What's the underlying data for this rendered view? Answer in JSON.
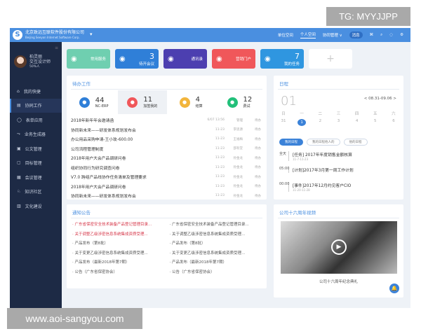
{
  "overlay_tag": "TG: MYYJJPP",
  "watermark": "www.aoi-sangyou.com",
  "header": {
    "company": "北京致远互联软件股份有限公司",
    "company_en": "Beijing Seeyon Internet Software Corp.",
    "nav": [
      "单位空间",
      "个人空间",
      "协同管理 ∨"
    ],
    "badge": "消息"
  },
  "user": {
    "name": "柏灵丽",
    "title": "交互设计师",
    "dept": "50%人"
  },
  "sidebar": {
    "items": [
      "我的快捷",
      "协同工作",
      "表单应用",
      "业务生成器",
      "公文管理",
      "目标管理",
      "会议管理",
      "知识社区",
      "文化建设"
    ],
    "active": 1
  },
  "tiles": [
    {
      "label": "常用服务",
      "num": "",
      "color": "#6fcfb0",
      "icon": "service-icon"
    },
    {
      "label": "待开会议",
      "num": "3",
      "color": "#2f7fd8",
      "icon": "meeting-icon"
    },
    {
      "label": "通讯录",
      "num": "",
      "color": "#4c3fb0",
      "icon": "contacts-icon"
    },
    {
      "label": "营销门户",
      "num": "",
      "color": "#f0575a",
      "icon": "portal-icon"
    },
    {
      "label": "我的任务",
      "num": "7",
      "color": "#2f96e0",
      "icon": "star-icon"
    }
  ],
  "todo": {
    "title": "待办工作",
    "stats": [
      {
        "n": "44",
        "l": "NC-ERP",
        "color": "#2f7fd8"
      },
      {
        "n": "11",
        "l": "加签我的",
        "color": "#f0575a"
      },
      {
        "n": "4",
        "l": "结算",
        "color": "#f2b53c"
      },
      {
        "n": "12",
        "l": "费试",
        "color": "#22c07a"
      }
    ],
    "rows": [
      {
        "t": "2018年新年年会邀请函",
        "d": "6/07 13:56",
        "p": "管理",
        "s": "待办"
      },
      {
        "t": "协同新未来——研发体系规划发布会",
        "d": "11-23",
        "p": "李思源",
        "s": "待办"
      },
      {
        "t": "办公用品采购申请-王小玫-600.00",
        "d": "11-23",
        "p": "王福梅",
        "s": "待办"
      },
      {
        "t": "公司流程管理制度",
        "d": "11-23",
        "p": "邵有堂",
        "s": "待办"
      },
      {
        "t": "2018年用户大会产品调研问卷",
        "d": "11-23",
        "p": "孙金龙",
        "s": "待办"
      },
      {
        "t": "组织协同行为研究调查问卷",
        "d": "11-23",
        "p": "孙金龙",
        "s": "待办"
      },
      {
        "t": "V7.0 跨组产品线协作任务清单及管理要求",
        "d": "11-23",
        "p": "孙金龙",
        "s": "待办"
      },
      {
        "t": "2018年用户大会产品调研问卷",
        "d": "11-23",
        "p": "孙金龙",
        "s": "待办"
      },
      {
        "t": "协同新未来——研发体系规划发布会",
        "d": "11-23",
        "p": "孙金龙",
        "s": "待办"
      }
    ]
  },
  "schedule": {
    "title": "日程",
    "big": "01",
    "range": "< 08.31-09.06 >",
    "week": [
      "日",
      "一",
      "二",
      "三",
      "四",
      "五",
      "六"
    ],
    "days": [
      "31",
      "1",
      "2",
      "3",
      "4",
      "5",
      "6"
    ],
    "today": 1,
    "filters": [
      "我的日程",
      "我的日程他人的",
      "他的日程"
    ],
    "events": [
      {
        "tm": "全天",
        "t": "[任务] 2017年年度销售金额核算",
        "s": "11-7-11-23"
      },
      {
        "tm": "05:00",
        "t": "[计划]2017年3月第一周工作计划",
        "s": ""
      },
      {
        "tm": "00:00",
        "t": "[事件]2017年12月约见客户CIO",
        "s": "11-20-11-28"
      }
    ]
  },
  "notices": {
    "title": "通知公告",
    "items": [
      {
        "t": "· 广东省保密安全技术装备产品登记管理目录...",
        "red": true
      },
      {
        "t": "· 广东省保密安全技术装备产品登记管理目录...",
        "red": false
      },
      {
        "t": "· 关于调整乙级涉密信息系统集成资质受理...",
        "red": true
      },
      {
        "t": "· 关于调整乙级涉密信息系统集成资质受理...",
        "red": false
      },
      {
        "t": "· 产品发布（第8批）",
        "red": false
      },
      {
        "t": "· 产品发布（第8批）",
        "red": false
      },
      {
        "t": "· 关于变更乙级涉密信息系统集成资质受理...",
        "red": false
      },
      {
        "t": "· 关于变更乙级涉密信息系统集成资质受理...",
        "red": false
      },
      {
        "t": "· 产品发布（最新2018年第7期）",
        "red": false
      },
      {
        "t": "· 产品发布（最新2018年第7期）",
        "red": false
      },
      {
        "t": "· 公告（广东省保密协会）",
        "red": false
      },
      {
        "t": "· 公告（广东省保密协会）",
        "red": false
      }
    ]
  },
  "video": {
    "title": "公司十六周年视频",
    "caption": "公司十六周年纪念典礼"
  }
}
